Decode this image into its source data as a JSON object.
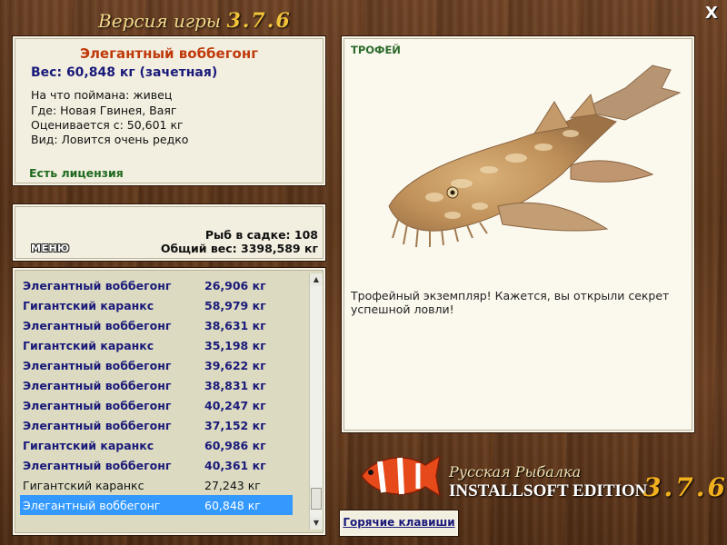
{
  "window": {
    "title_prefix": "Версия игры",
    "title_version": "3.7.6",
    "close_label": "X"
  },
  "info": {
    "fish_name": "Элегантный воббегонг",
    "weight": "Вес: 60,848 кг (зачетная)",
    "lines": [
      "На что поймана: живец",
      "Где: Новая Гвинея, Ваяг",
      "Оценивается с: 50,601 кг",
      "Вид: Ловится очень редко"
    ],
    "license": "Есть лицензия"
  },
  "stats": {
    "menu_label": "МЕНЮ",
    "fish_count": "Рыб в садке: 108",
    "total_weight": "Общий вес: 3398,589 кг"
  },
  "catch_list": [
    {
      "name": "Элегантный воббегонг",
      "weight": "26,906 кг",
      "style": "bold"
    },
    {
      "name": "Гигантский каранкс",
      "weight": "58,979 кг",
      "style": "bold"
    },
    {
      "name": "Элегантный воббегонг",
      "weight": "38,631 кг",
      "style": "bold"
    },
    {
      "name": "Гигантский каранкс",
      "weight": "35,198 кг",
      "style": "bold"
    },
    {
      "name": "Элегантный воббегонг",
      "weight": "39,622 кг",
      "style": "bold"
    },
    {
      "name": "Элегантный воббегонг",
      "weight": "38,831 кг",
      "style": "bold"
    },
    {
      "name": "Элегантный воббегонг",
      "weight": "40,247 кг",
      "style": "bold"
    },
    {
      "name": "Элегантный воббегонг",
      "weight": "37,152 кг",
      "style": "bold"
    },
    {
      "name": "Гигантский каранкс",
      "weight": "60,986 кг",
      "style": "bold"
    },
    {
      "name": "Элегантный воббегонг",
      "weight": "40,361 кг",
      "style": "bold"
    },
    {
      "name": "Гигантский каранкс",
      "weight": "27,243 кг",
      "style": "plain"
    },
    {
      "name": "Элегантный воббегонг",
      "weight": "60,848 кг",
      "style": "selected"
    }
  ],
  "trophy": {
    "label": "ТРОФЕЙ",
    "text": "Трофейный экземпляр! Кажется, вы открыли секрет успешной ловли!"
  },
  "logo": {
    "line1": "Русская Рыбалка",
    "line2": "INSTALLSOFT EDITION",
    "version": "3.7.6"
  },
  "hotkeys_label": "Горячие клавиши",
  "colors": {
    "fish_name": "#c0390b",
    "weight_blue": "#1a1a7a",
    "license_green": "#1f6a1f",
    "selection": "#3399ff",
    "version_gold": "#f2b01e"
  }
}
